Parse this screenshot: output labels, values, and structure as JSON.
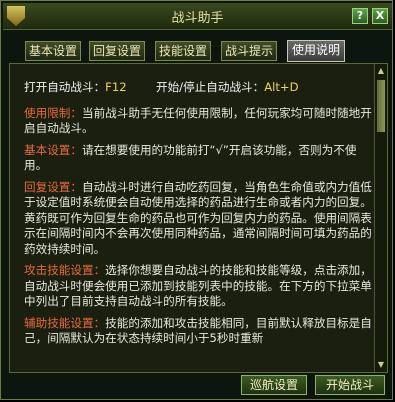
{
  "window": {
    "title": "战斗助手",
    "help_btn": "?",
    "close_btn": "X"
  },
  "tabs": [
    {
      "label": "基本设置"
    },
    {
      "label": "回复设置"
    },
    {
      "label": "技能设置"
    },
    {
      "label": "战斗提示"
    },
    {
      "label": "使用说明"
    }
  ],
  "content": {
    "hotkey_auto_label": "打开自动战斗：",
    "hotkey_auto_key": "F12",
    "hotkey_toggle_label": "开始/停止自动战斗：",
    "hotkey_toggle_key": "Alt+D",
    "sections": [
      {
        "heading": "使用限制：",
        "body": "当前战斗助手无任何使用限制，任何玩家均可随时随地开启自动战斗。"
      },
      {
        "heading": "基本设置：",
        "body": "请在想要使用的功能前打“√”开启该功能，否则为不使用。"
      },
      {
        "heading": "回复设置：",
        "body": "自动战斗时进行自动吃药回复，当角色生命值或内力值低于设定值时系统便会自动使用选择的药品进行生命或者内力的回复。黄药既可作为回复生命的药品也可作为回复内力的药品。使用间隔表示在间隔时间内不会再次使用同种药品，通常间隔时间可填为药品的药效持续时间。"
      },
      {
        "heading": "攻击技能设置：",
        "body": "选择你想要自动战斗的技能和技能等级，点击添加，自动战斗时便会使用已添加到技能列表中的技能。在下方的下拉菜单中列出了目前支持自动战斗的所有技能。"
      },
      {
        "heading": "辅助技能设置：",
        "body": "技能的添加和攻击技能相同，目前默认释放目标是自己，间隔默认为在状态持续时间小于5秒时重新"
      }
    ]
  },
  "buttons": {
    "patrol": "巡航设置",
    "start": "开始战斗"
  }
}
